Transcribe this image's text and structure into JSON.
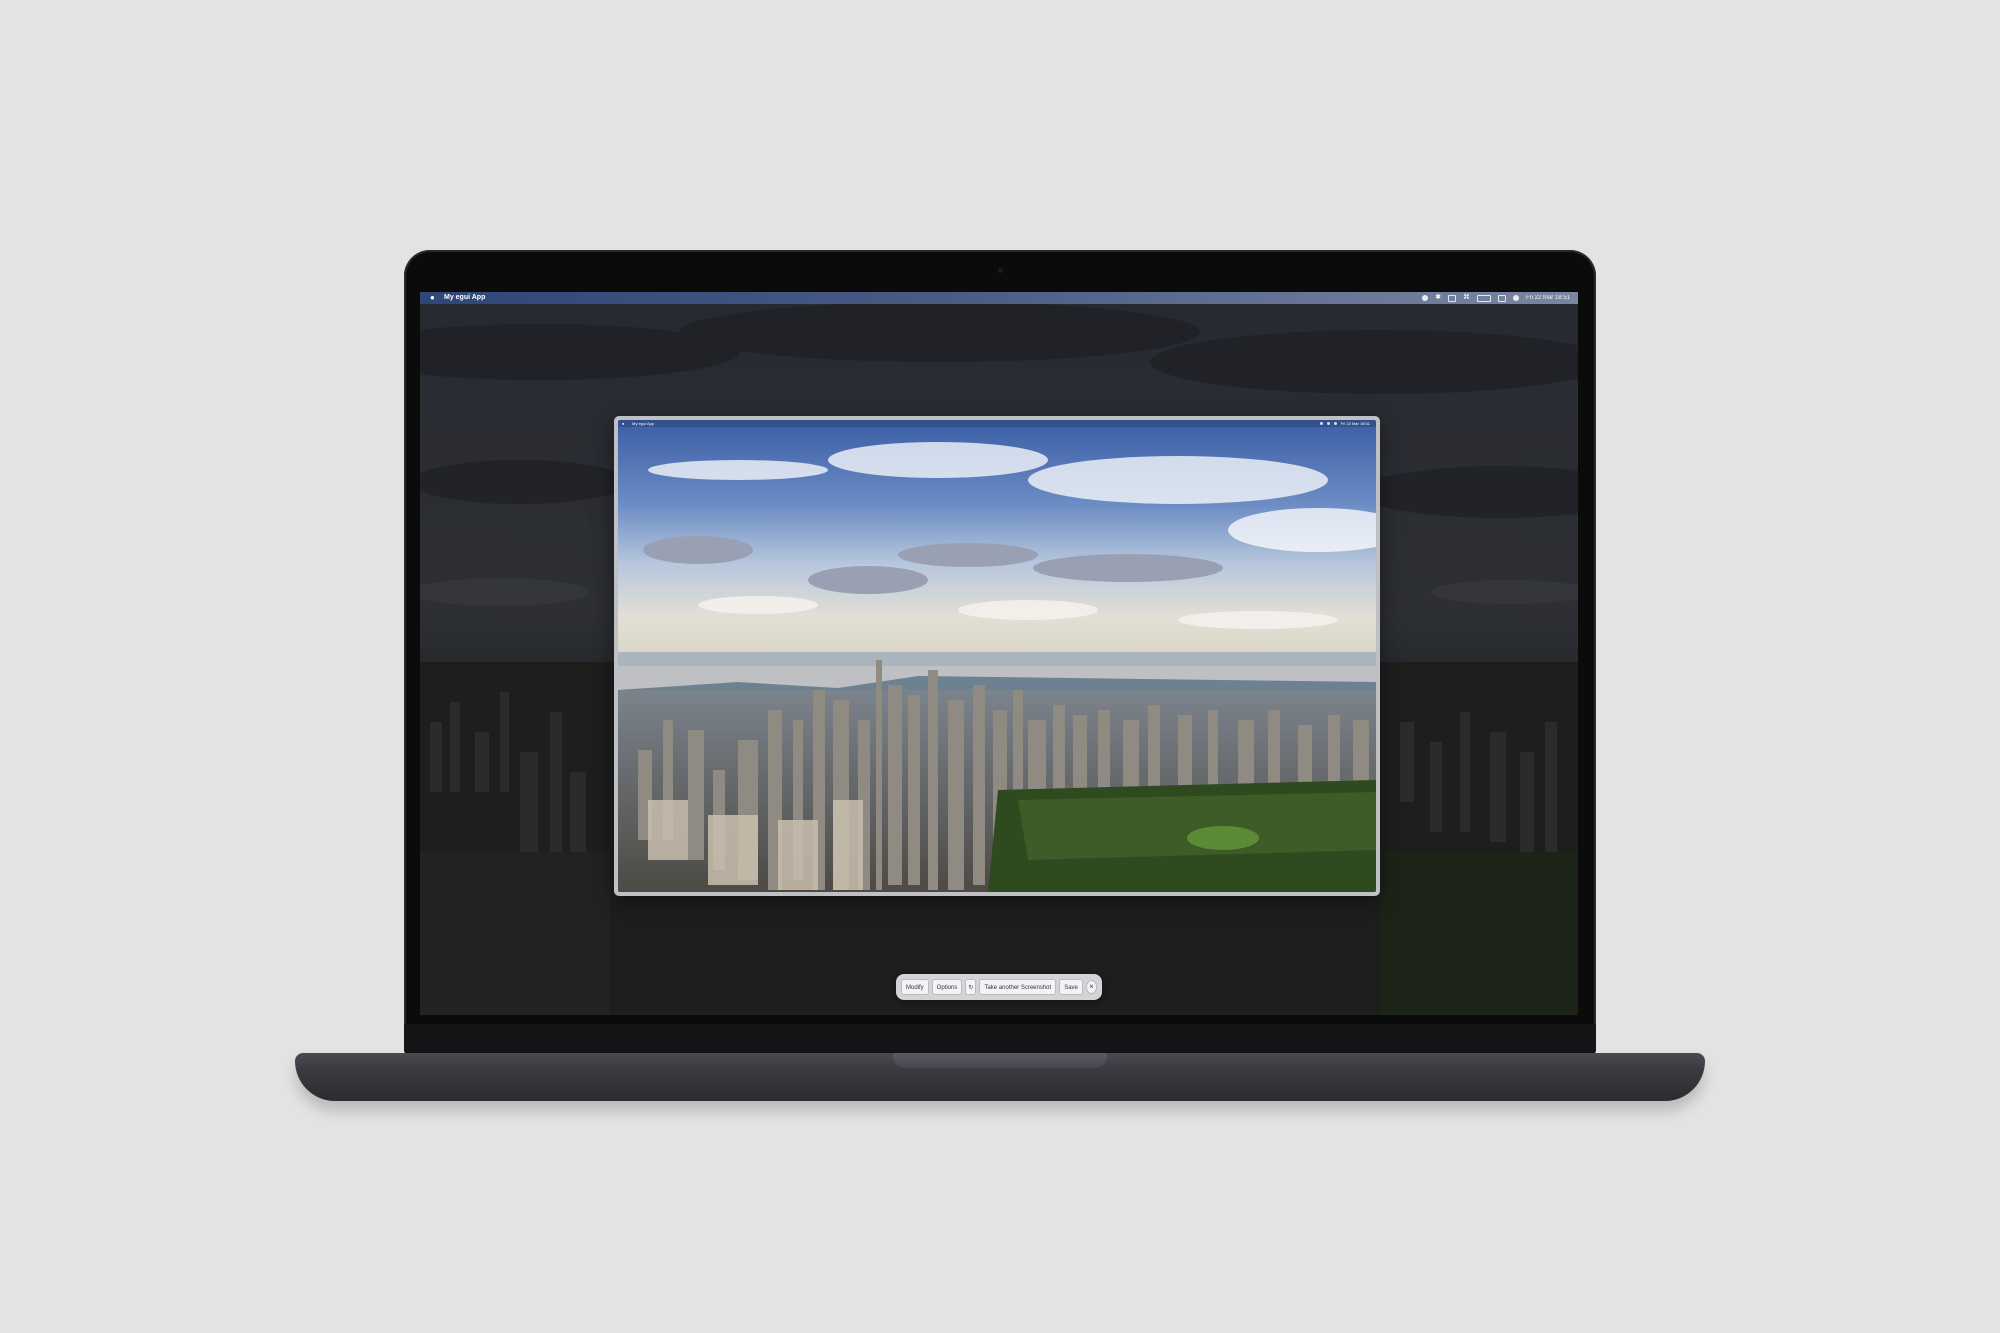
{
  "menubar": {
    "apple_icon": "apple-logo-icon",
    "app_name": "My egui App",
    "datetime": "Fri 22 Mar 18:51",
    "status_icons": [
      "sync-icon",
      "bluetooth-icon",
      "volume-icon",
      "wifi-icon",
      "battery-icon",
      "control-center-icon",
      "siri-icon"
    ]
  },
  "preview_window": {
    "app_name": "My egui App",
    "datetime": "Fri 22 Mar 18:51"
  },
  "toolbar": {
    "modify_label": "Modify",
    "options_label": "Options",
    "refresh_icon": "refresh-icon",
    "take_another_label": "Take another Screenshot",
    "save_label": "Save",
    "close_icon": "close-icon"
  },
  "colors": {
    "page_bg": "#e3e3e3",
    "laptop_body": "#0b0b0c",
    "laptop_base": "#3a3a40",
    "menubar_start": "#2f4677",
    "toolbar_bg": "#d3d4d8"
  }
}
